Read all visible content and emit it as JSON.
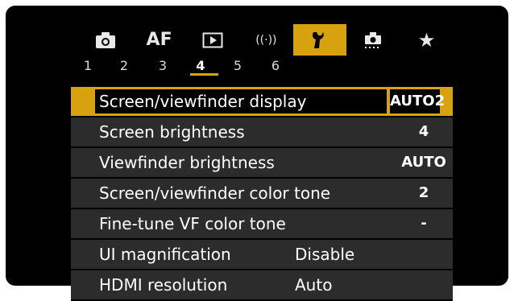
{
  "tabs": [
    {
      "icon": "camera-icon",
      "label": ""
    },
    {
      "icon": "af-icon",
      "label": "AF"
    },
    {
      "icon": "playback-icon",
      "label": ""
    },
    {
      "icon": "wireless-icon",
      "label": "((·))"
    },
    {
      "icon": "wrench-icon",
      "label": ""
    },
    {
      "icon": "custom-functions-icon",
      "label": ""
    },
    {
      "icon": "star-icon",
      "label": "★"
    }
  ],
  "subtabs": [
    "1",
    "2",
    "3",
    "4",
    "5",
    "6"
  ],
  "active_subtab": "4",
  "menu": {
    "items": [
      {
        "label": "Screen/viewfinder display",
        "value": "AUTO2"
      },
      {
        "label": "Screen brightness",
        "value": "4"
      },
      {
        "label": "Viewfinder brightness",
        "value": "AUTO"
      },
      {
        "label": "Screen/viewfinder color tone",
        "value": "2"
      },
      {
        "label": "Fine-tune VF color tone",
        "value": "-"
      },
      {
        "label": "UI magnification",
        "value": "Disable"
      },
      {
        "label": "HDMI resolution",
        "value": "Auto"
      }
    ]
  },
  "colors": {
    "accent": "#d7a20e",
    "row_bg": "#2c2c2c",
    "screen_bg": "#000000"
  }
}
